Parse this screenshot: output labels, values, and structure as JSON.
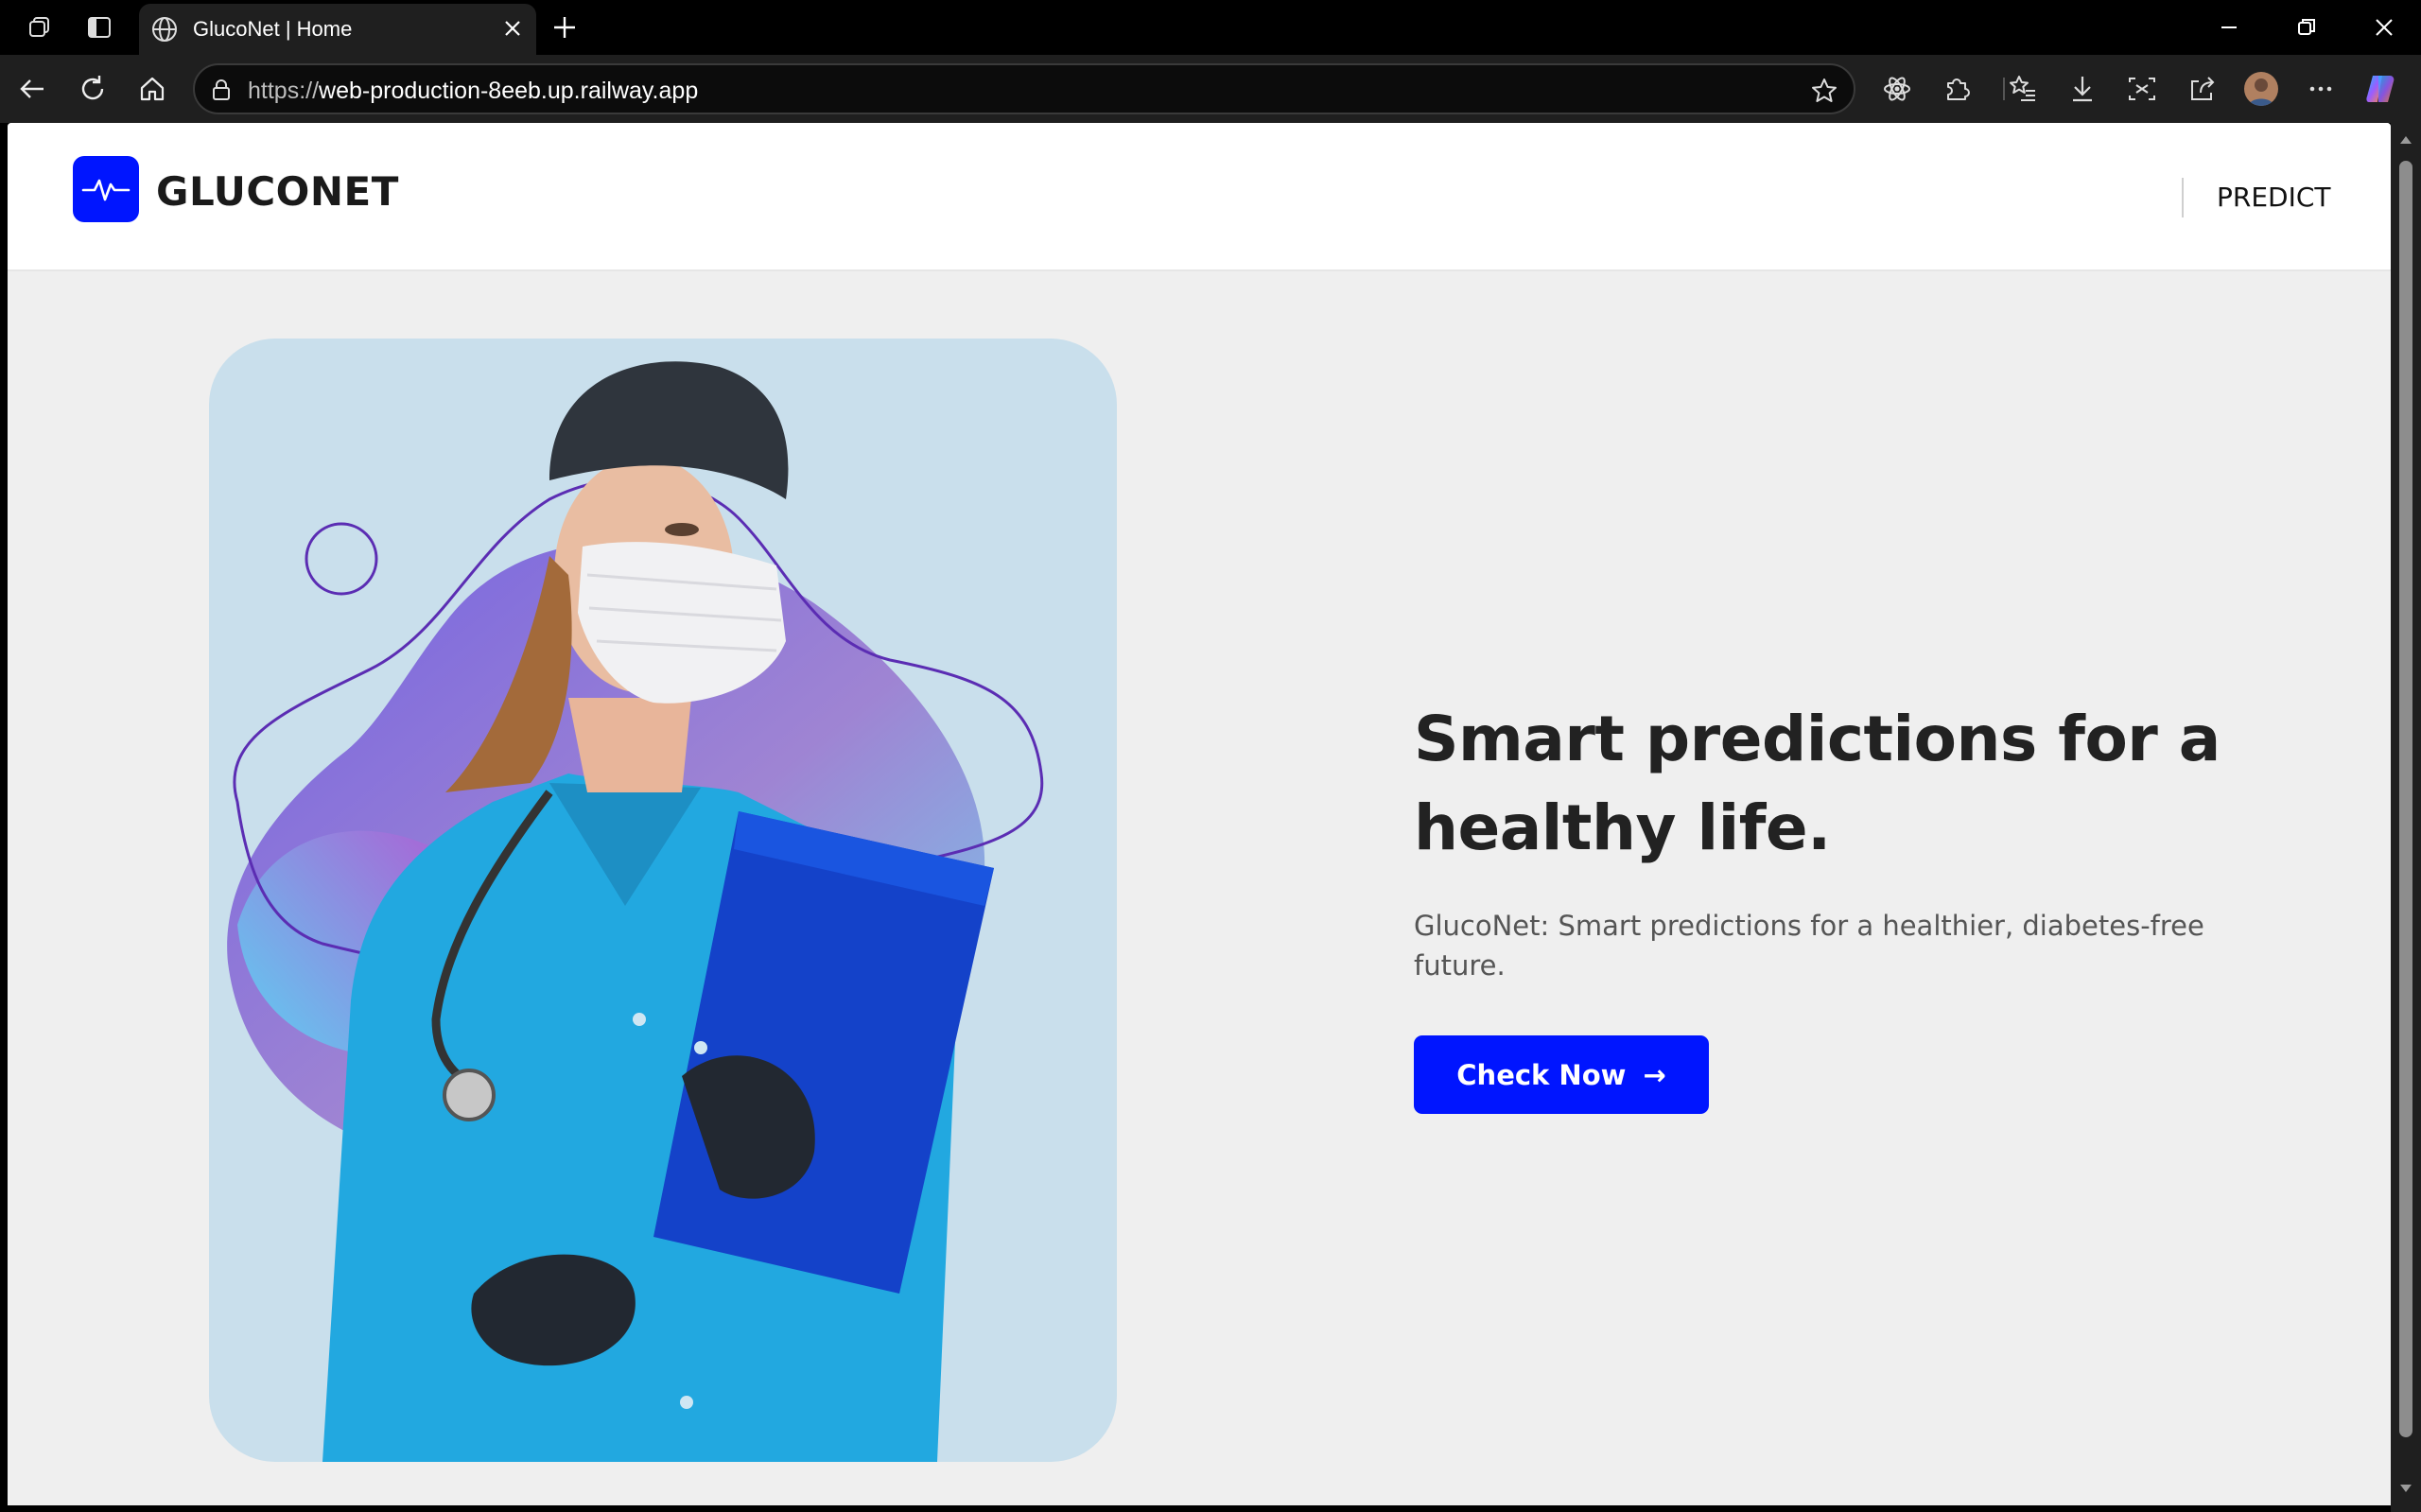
{
  "browser": {
    "tab_title": "GlucoNet | Home",
    "url_protocol": "https://",
    "url_host": "web-production-8eeb.up.railway.app"
  },
  "site": {
    "brand": "GLUCONET",
    "nav_link": "PREDICT",
    "accent_color": "#0015ff"
  },
  "hero": {
    "title": "Smart predictions for a healthy life.",
    "subtitle": "GlucoNet: Smart predictions for a healthier, diabetes-free future.",
    "cta_label": "Check Now",
    "cta_arrow": "→"
  }
}
